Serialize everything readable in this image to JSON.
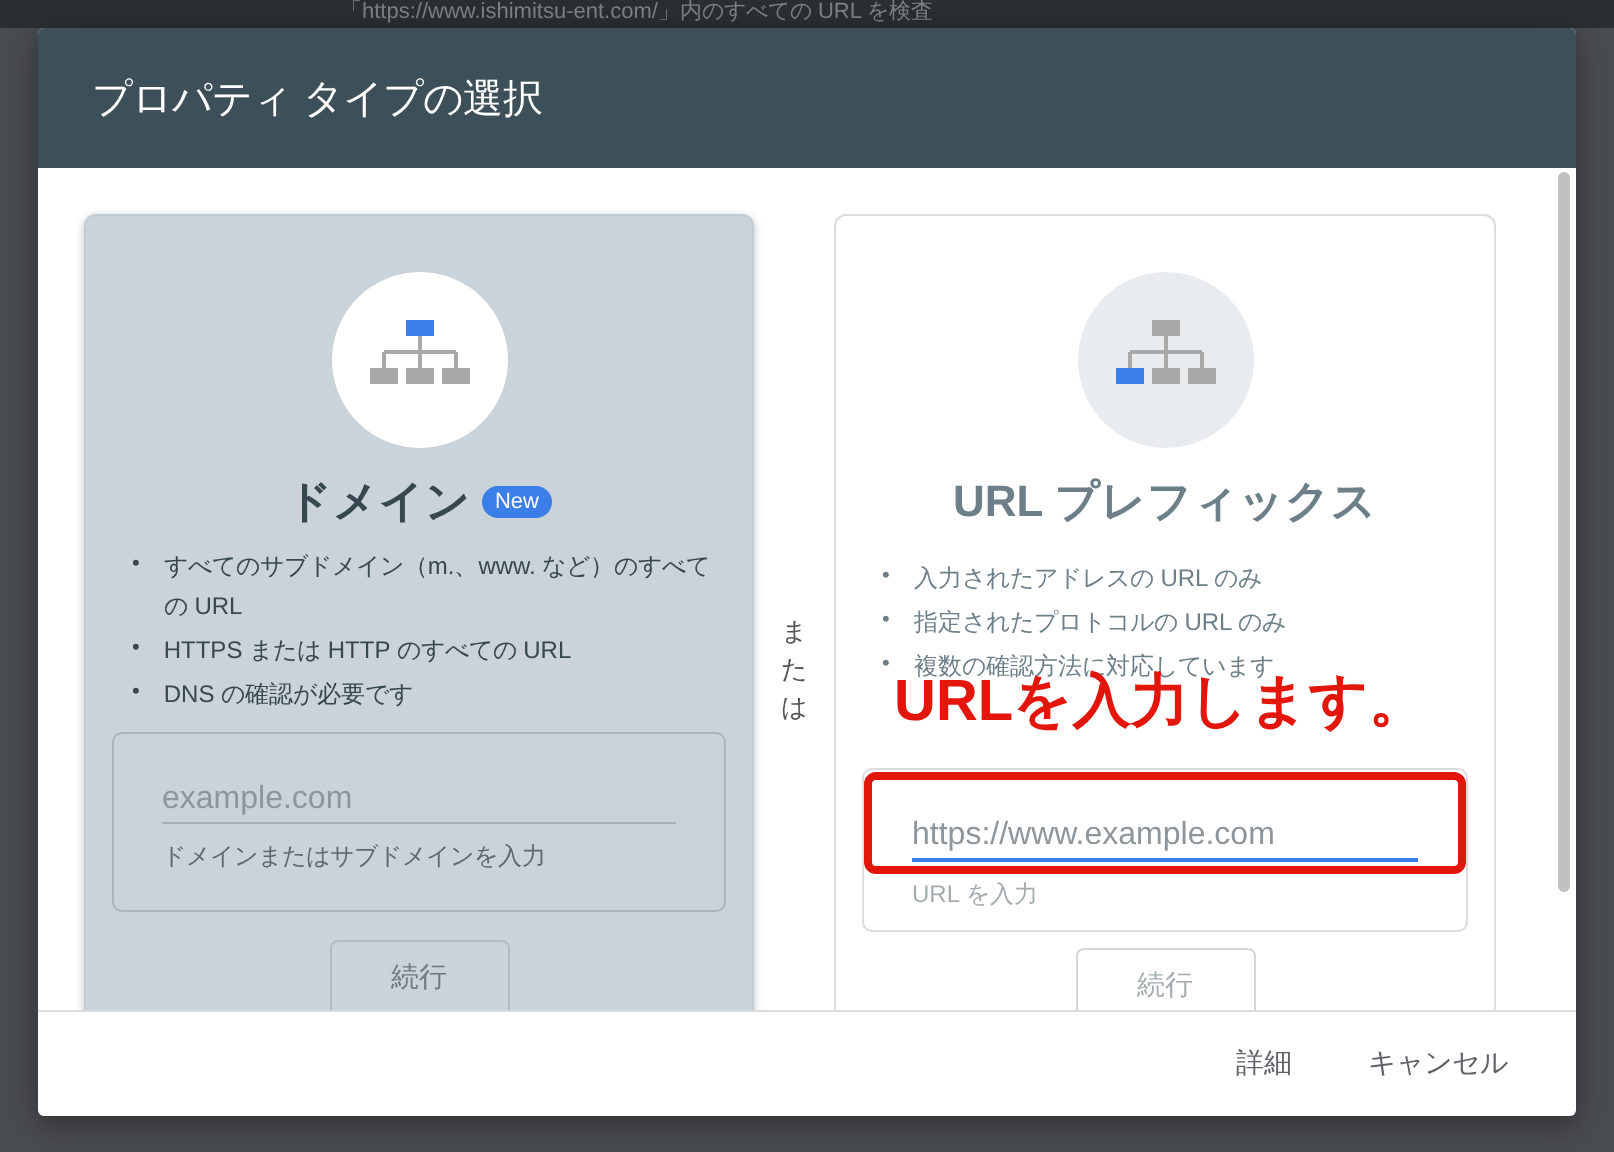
{
  "background": {
    "search_text": "「https://www.ishimitsu-ent.com/」内のすべての URL を検査"
  },
  "dialog": {
    "title": "プロパティ タイプの選択",
    "options": [
      {
        "kind": "domain",
        "title": "ドメイン",
        "badge": "New",
        "selected": true,
        "bullet_mark": "•",
        "bullets": [
          "すべてのサブドメイン（m.、www. など）のすべての URL",
          "HTTPS または HTTP のすべての URL",
          "DNS の確認が必要です"
        ],
        "input": {
          "placeholder": "example.com",
          "helper": "ドメインまたはサブドメインを入力",
          "focused": false
        },
        "button": "続行"
      },
      {
        "kind": "url_prefix",
        "title": "URL プレフィックス",
        "selected": false,
        "bullet_mark": "•",
        "bullets": [
          "入力されたアドレスの URL のみ",
          "指定されたプロトコルの URL のみ",
          "複数の確認方法に対応しています"
        ],
        "input": {
          "placeholder": "https://www.example.com",
          "helper": "URL を入力",
          "focused": true
        },
        "button": "続行"
      }
    ],
    "separator": "または",
    "annotation": "URLを入力します。",
    "footer_buttons": [
      "詳細",
      "キャンセル"
    ]
  }
}
